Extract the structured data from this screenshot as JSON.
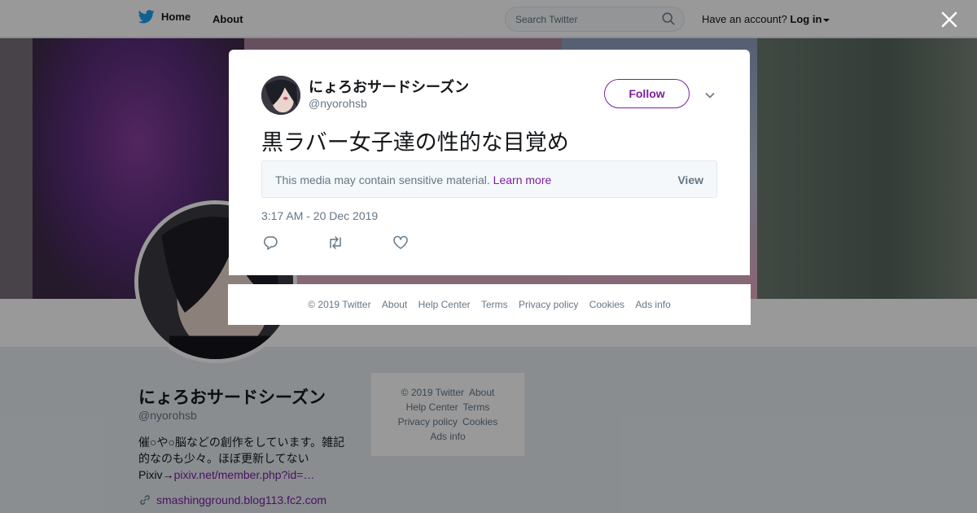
{
  "nav": {
    "home_label": "Home",
    "about_label": "About",
    "search_placeholder": "Search Twitter",
    "account_prompt": "Have an account?",
    "login_label": "Log in"
  },
  "colors": {
    "brand_blue": "#1da1f2",
    "accent_purple": "#7b1fa2",
    "overlay": "rgba(0,0,0,0.4)"
  },
  "profile": {
    "name": "にょろおサードシーズン",
    "handle": "@nyorohsb",
    "bio_line1": "催○や○脳などの創作をしています。雑記的なのも少々。ほぼ更新してない",
    "bio_prefix": "Pixiv→",
    "bio_link": "pixiv.net/member.php?id=…",
    "url": "smashingground.blog113.fc2.com"
  },
  "side_footer": {
    "items": [
      "© 2019 Twitter",
      "About",
      "Help Center",
      "Terms",
      "Privacy policy",
      "Cookies",
      "Ads info"
    ]
  },
  "tweet": {
    "author_name": "にょろおサードシーズン",
    "author_handle": "@nyorohsb",
    "follow_label": "Follow",
    "text": "黒ラバー女子達の性的な目覚め",
    "sensitive_notice": "This media may contain sensitive material.",
    "learn_more": "Learn more",
    "view_label": "View",
    "timestamp": "3:17 AM - 20 Dec 2019",
    "icons": [
      "reply-icon",
      "retweet-icon",
      "like-icon"
    ]
  },
  "modal_footer": {
    "items": [
      "© 2019 Twitter",
      "About",
      "Help Center",
      "Terms",
      "Privacy policy",
      "Cookies",
      "Ads info"
    ]
  }
}
